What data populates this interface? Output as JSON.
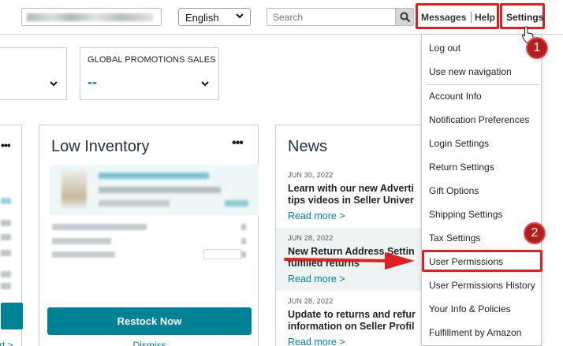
{
  "header": {
    "language": "English",
    "search_placeholder": "Search",
    "messages_label": "Messages",
    "help_label": "Help",
    "settings_label": "Settings"
  },
  "kpi": {
    "global_title": "GLOBAL PROMOTIONS SALES",
    "global_value": "--"
  },
  "inventory": {
    "title": "Low Inventory",
    "restock_label": "Restock Now",
    "dismiss_label": "Dismiss"
  },
  "left_card": {
    "link_fragment": "rt >"
  },
  "news": {
    "title": "News",
    "items": [
      {
        "date": "JUN 30, 2022",
        "line1": "Learn with our new Adverti",
        "line2": "tips videos in Seller Univer",
        "more": "Read more >"
      },
      {
        "date": "JUN 28, 2022",
        "line1": "New Return Address Settin",
        "line2": "fulfilled returns",
        "more": "Read more >"
      },
      {
        "date": "JUN 28, 2022",
        "line1": "Update to returns and refur",
        "line2": "information on Seller Profil",
        "more": "Read more >"
      }
    ]
  },
  "settings_menu": {
    "items": [
      "Log out",
      "Use new navigation",
      "Account Info",
      "Notification Preferences",
      "Login Settings",
      "Return Settings",
      "Gift Options",
      "Shipping Settings",
      "Tax Settings",
      "User Permissions",
      "User Permissions History",
      "Your Info & Policies",
      "Fulfillment by Amazon"
    ]
  },
  "annotations": {
    "step1": "1",
    "step2": "2"
  },
  "colors": {
    "accent": "#008296",
    "annotation_red": "#e02020",
    "badge_fill": "#b01e1e"
  },
  "icons": [
    "chevron-down-icon",
    "search-icon",
    "more-dots-icon",
    "pointer-cursor-icon",
    "red-arrow-icon"
  ]
}
